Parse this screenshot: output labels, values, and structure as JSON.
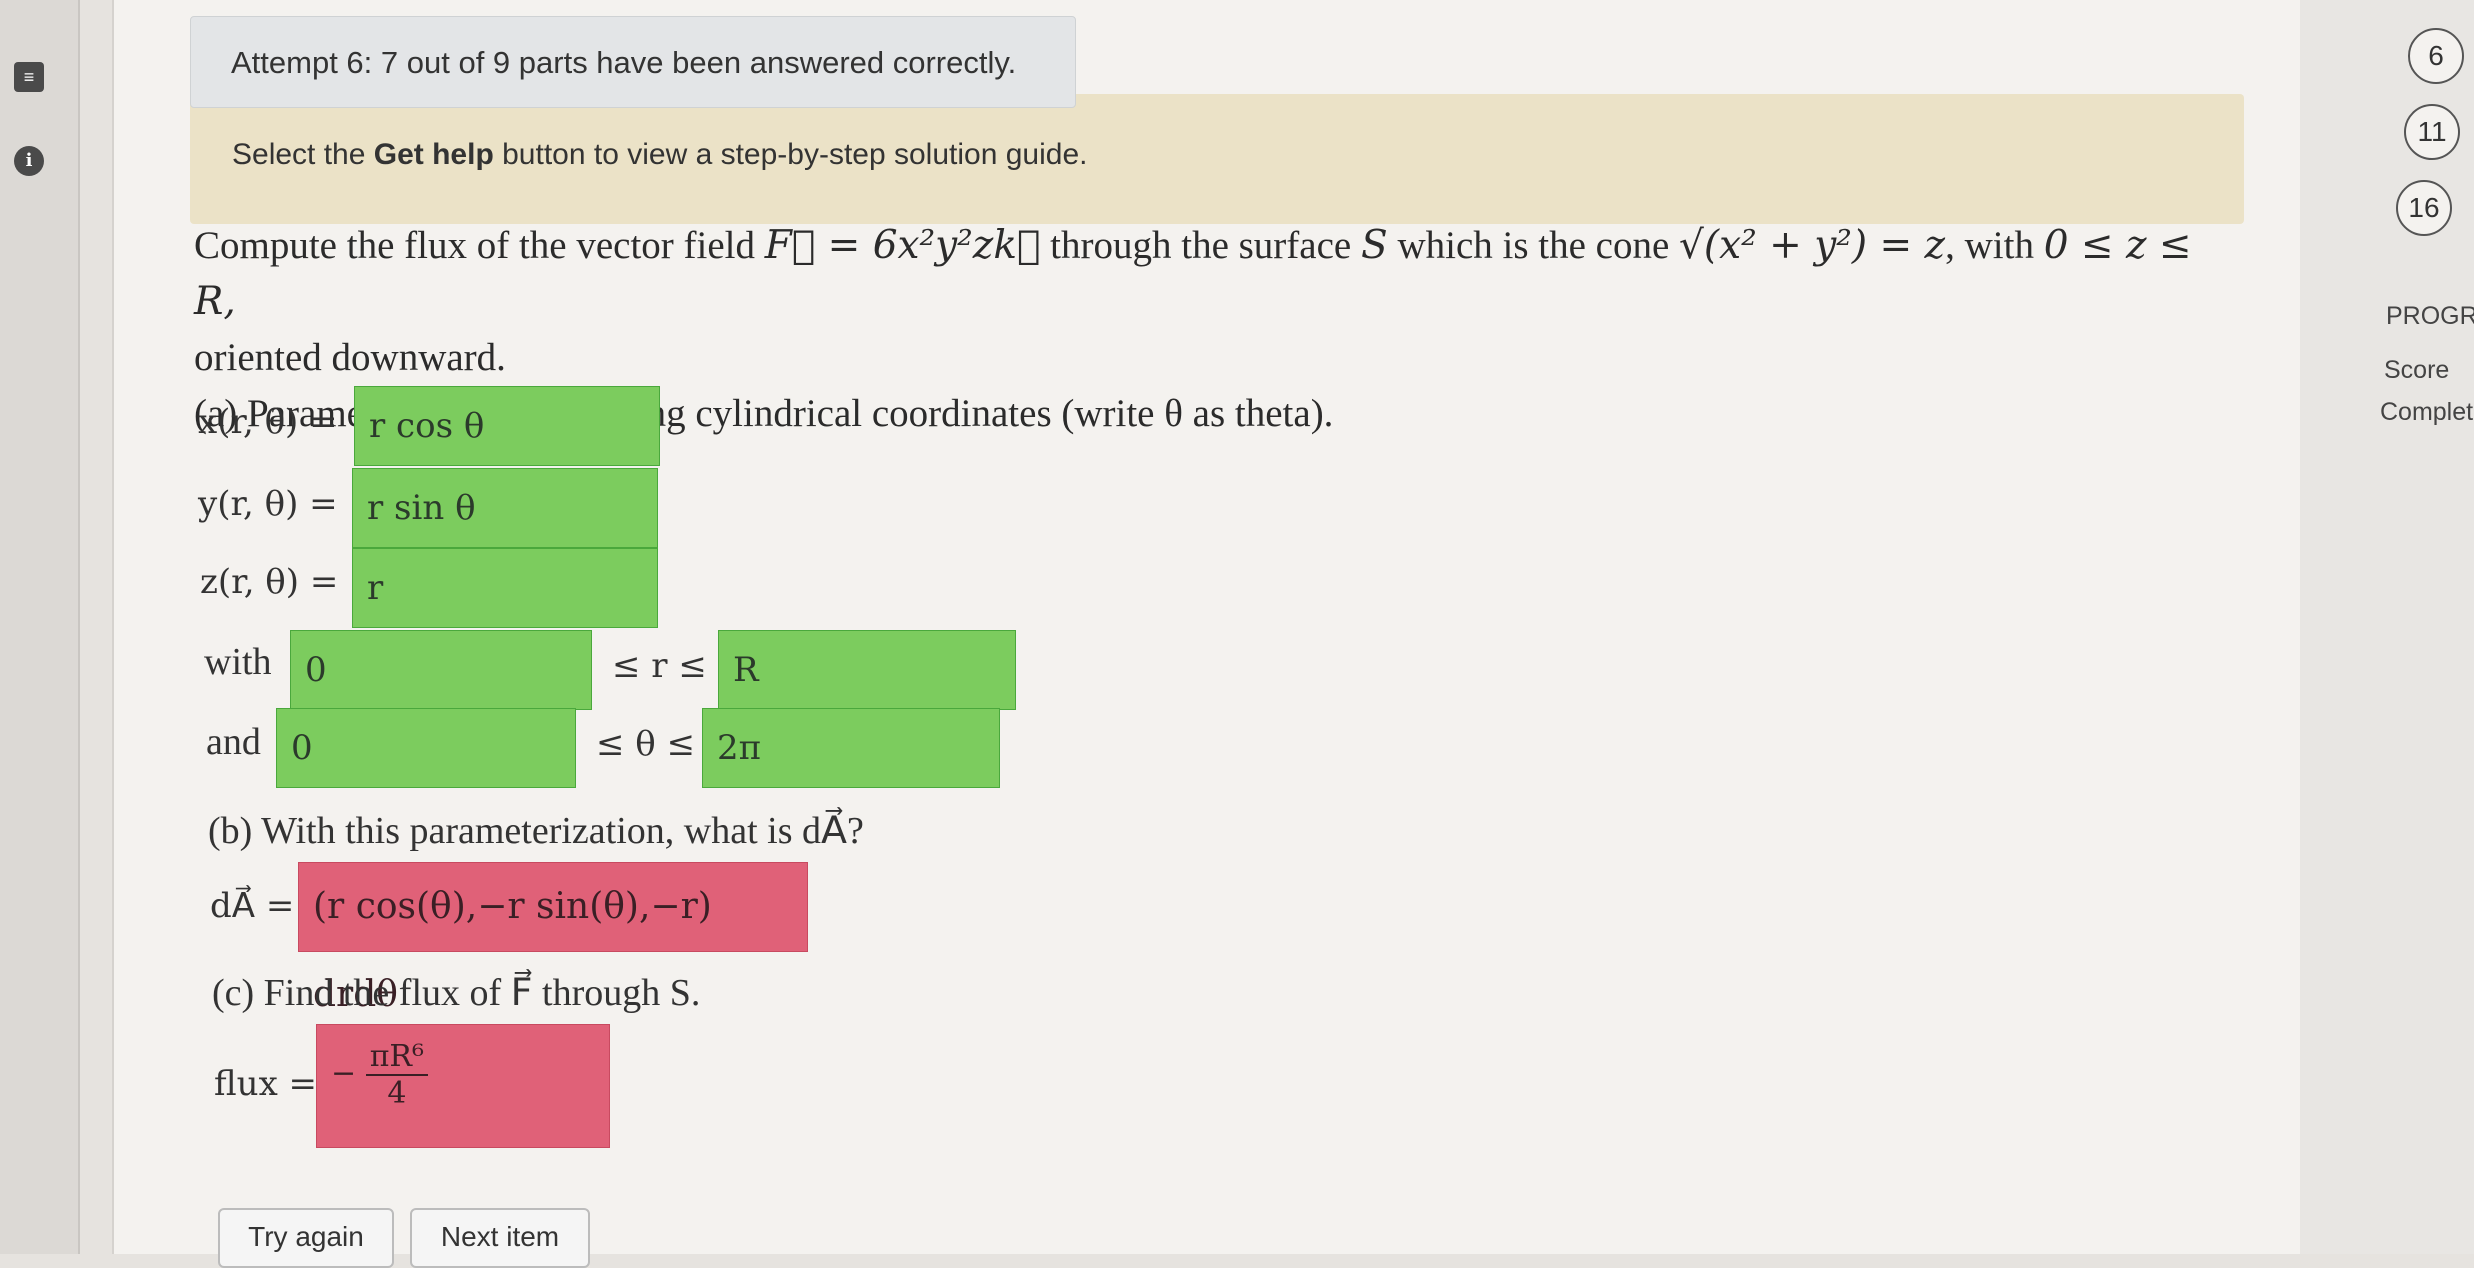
{
  "sidebar": {
    "doc_icon": "document-icon",
    "info_icon": "info-icon",
    "info_glyph": "i"
  },
  "attempt_banner": "Attempt 6: 7 out of 9 parts have been answered correctly.",
  "help_banner": {
    "prefix": "Select the ",
    "bold": "Get help",
    "suffix": " button to view a step-by-step solution guide."
  },
  "problem": {
    "line1_a": "Compute the flux of the vector field ",
    "field": "F⃗ = 6x²y²zk⃗",
    "line1_b": " through the surface ",
    "S": "S",
    "line1_c": " which is the cone ",
    "cone": "√(x² + y²) = z",
    "line1_d": ", with ",
    "range": "0 ≤ z ≤ R,",
    "line2": "oriented downward.",
    "part_a": "(a) Parameterize the cone using cylindrical coordinates (write θ as theta)."
  },
  "part_a": {
    "x_label": "x(r, θ) =",
    "x_value": "r cos θ",
    "y_label": "y(r, θ) =",
    "y_value": "r sin θ",
    "z_label": "z(r, θ) =",
    "z_value": "r",
    "with_label": "with",
    "r_lower": "0",
    "r_between": "≤ r ≤",
    "r_upper": "R",
    "and_label": "and",
    "theta_lower": "0",
    "theta_between": "≤ θ ≤",
    "theta_upper": "2π"
  },
  "part_b": {
    "question": "(b) With this parameterization, what is dA⃗?",
    "label": "dA⃗ =",
    "value": "(r cos(θ),−r sin(θ),−r) drdθ"
  },
  "part_c": {
    "question": "(c) Find the flux of F⃗ through S.",
    "label": "flux =",
    "sign": "−",
    "numerator": "πR⁶",
    "denominator": "4"
  },
  "buttons": {
    "try_again": "Try again",
    "next_item": "Next item"
  },
  "right_panel": {
    "items": [
      "6",
      "11",
      "16"
    ],
    "progress_label": "PROGR",
    "score_label": "Score",
    "complete_label": "Complet"
  },
  "colors": {
    "correct": "#7ccc5e",
    "incorrect": "#e06178",
    "help_bg": "#ebe2c7"
  }
}
